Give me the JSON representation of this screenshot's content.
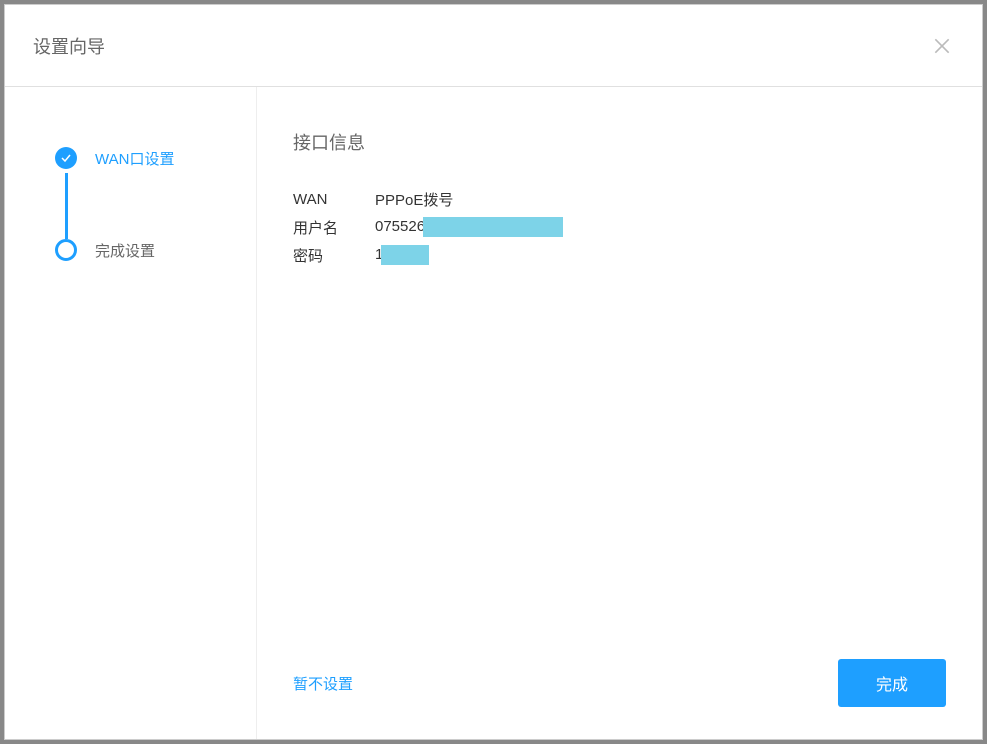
{
  "dialog": {
    "title": "设置向导"
  },
  "sidebar": {
    "steps": [
      {
        "label": "WAN口设置",
        "state": "completed"
      },
      {
        "label": "完成设置",
        "state": "current"
      }
    ]
  },
  "content": {
    "title": "接口信息",
    "rows": [
      {
        "label": "WAN",
        "value": "PPPoE拨号"
      },
      {
        "label": "用户名",
        "value": "075526",
        "redacted": true
      },
      {
        "label": "密码",
        "value": "1",
        "redacted": true
      }
    ]
  },
  "footer": {
    "skip_label": "暂不设置",
    "finish_label": "完成"
  }
}
